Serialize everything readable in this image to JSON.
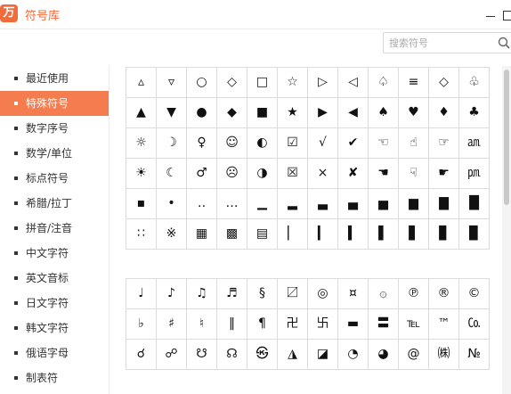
{
  "window": {
    "title": "符号库",
    "logo_text": "万"
  },
  "search": {
    "placeholder": "搜索符号"
  },
  "sidebar": {
    "items": [
      {
        "label": "最近使用",
        "active": false
      },
      {
        "label": "特殊符号",
        "active": true
      },
      {
        "label": "数字序号",
        "active": false
      },
      {
        "label": "数学/单位",
        "active": false
      },
      {
        "label": "标点符号",
        "active": false
      },
      {
        "label": "希腊/拉丁",
        "active": false
      },
      {
        "label": "拼音/注音",
        "active": false
      },
      {
        "label": "中文字符",
        "active": false
      },
      {
        "label": "英文音标",
        "active": false
      },
      {
        "label": "日文字符",
        "active": false
      },
      {
        "label": "韩文字符",
        "active": false
      },
      {
        "label": "俄语字母",
        "active": false
      },
      {
        "label": "制表符",
        "active": false
      }
    ]
  },
  "symbol_grids": [
    {
      "rows": [
        [
          "▵",
          "▿",
          "○",
          "◇",
          "□",
          "☆",
          "▷",
          "◁",
          "♤",
          "≡",
          "◇",
          "♧"
        ],
        [
          "▲",
          "▼",
          "●",
          "◆",
          "■",
          "★",
          "▶",
          "◀",
          "♠",
          "♥",
          "♦",
          "♣"
        ],
        [
          "☼",
          "☽",
          "♀",
          "☺",
          "◐",
          "☑",
          "√",
          "✔",
          "☜",
          "☝",
          "☞",
          "㏂"
        ],
        [
          "☀",
          "☾",
          "♂",
          "☹",
          "◑",
          "☒",
          "×",
          "✘",
          "☚",
          "☟",
          "☛",
          "㏘"
        ],
        [
          "▪",
          "•",
          "‥",
          "…",
          "▁",
          "▂",
          "▃",
          "▄",
          "▅",
          "▆",
          "▇",
          "█"
        ],
        [
          "∷",
          "※",
          "▦",
          "▩",
          "▤",
          "▏",
          "▎",
          "▍",
          "▌",
          "▋",
          "▊",
          "▉"
        ]
      ]
    },
    {
      "rows": [
        [
          "♩",
          "♪",
          "♫",
          "♬",
          "§",
          "〼",
          "◎",
          "¤",
          "۞",
          "℗",
          "®",
          "©"
        ],
        [
          "♭",
          "♯",
          "♮",
          "‖",
          "¶",
          "卍",
          "卐",
          "▬",
          "〓",
          "℡",
          "™",
          "㏇"
        ],
        [
          "☌",
          "☍",
          "☋",
          "☊",
          "㉿",
          "◮",
          "◪",
          "◔",
          "◕",
          "@",
          "㈱",
          "№"
        ]
      ]
    }
  ]
}
